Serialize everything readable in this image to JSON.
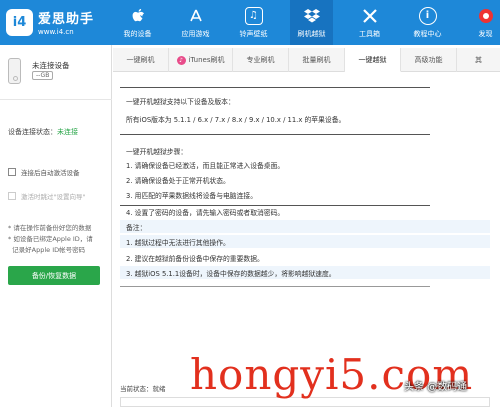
{
  "brand": {
    "title": "爱思助手",
    "url": "www.i4.cn",
    "mark": "i4"
  },
  "nav": [
    {
      "label": "我的设备",
      "icon": "apple-icon",
      "glyph": ""
    },
    {
      "label": "应用游戏",
      "icon": "appstore-icon",
      "glyph": "A"
    },
    {
      "label": "铃声壁纸",
      "icon": "music-icon",
      "glyph": "♫"
    },
    {
      "label": "刷机越狱",
      "icon": "dropbox-icon",
      "glyph": "❖"
    },
    {
      "label": "工具箱",
      "icon": "tools-icon",
      "glyph": "✕"
    },
    {
      "label": "教程中心",
      "icon": "info-icon",
      "glyph": "i"
    },
    {
      "label": "发现",
      "icon": "discover-icon",
      "glyph": "●"
    }
  ],
  "device": {
    "name": "未连接设备",
    "tag": "--GB"
  },
  "connection": {
    "label": "设备连接状态：",
    "status": "未连接"
  },
  "options": {
    "auto_activate": "连接后自动激活设备",
    "skip_guide": "激活时跳过\"设置向导\""
  },
  "notes": [
    "* 请在操作前备份好您的数据",
    "* 如设备已绑定Apple ID，请",
    "  记录好Apple ID帐号密码"
  ],
  "backup_button": "备份/恢复数据",
  "tabs": [
    "一键刷机",
    "iTunes刷机",
    "专业刷机",
    "批量刷机",
    "一键越狱",
    "高级功能",
    "其"
  ],
  "content": {
    "support_title": "一键开机越狱支持以下设备及版本：",
    "support_desc": "所有iOS版本为 5.1.1 / 6.x / 7.x / 8.x / 9.x / 10.x / 11.x 的苹果设备。",
    "steps_title": "一键开机越狱步骤：",
    "steps": [
      "1. 请确保设备已经激活，而且能正常进入设备桌面。",
      "2. 请确保设备处于正常开机状态。",
      "3. 用匹配的苹果数据线将设备与电脑连接。",
      "4. 设置了密码的设备，请先输入密码或者取消密码。"
    ],
    "notes_title": "备注：",
    "notes": [
      "1. 越狱过程中无法进行其他操作。",
      "2. 建议在越狱前备份设备中保存的重要数据。",
      "3. 越狱iOS 5.1.1设备时，设备中保存的数据越少，将影响越狱速度。"
    ]
  },
  "status": {
    "label": "当前状态：",
    "value": "就绪"
  },
  "watermark": {
    "main": "hongyi5.com",
    "sub": "头条 @数码通"
  }
}
